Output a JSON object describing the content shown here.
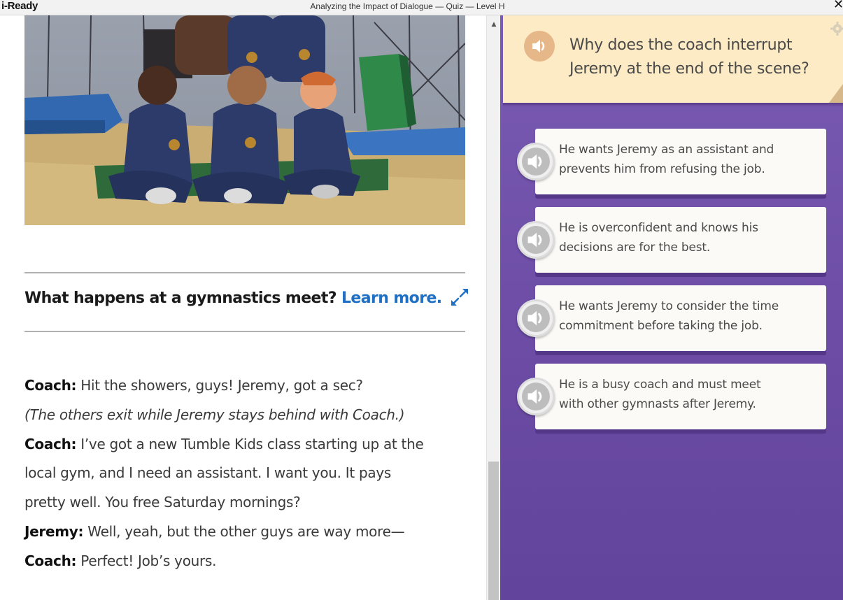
{
  "window": {
    "logo": "i-Ready",
    "title": "Analyzing the Impact of Dialogue — Quiz — Level H",
    "close_icon": "✕"
  },
  "reading": {
    "illustration": "gymnastics-team-illustration",
    "sidebar_prompt": "What happens at a gymnastics meet?",
    "learn_more": "Learn more.",
    "story_lines": [
      {
        "speaker": "Coach:",
        "text": " Hit the showers, guys! Jeremy, got a sec?"
      },
      {
        "stage": "(The others exit while Jeremy stays behind with Coach.)"
      },
      {
        "speaker": "Coach:",
        "text": " I’ve got a new Tumble Kids class starting up at the"
      },
      {
        "text": "local gym, and I need an assistant. I want you. It pays"
      },
      {
        "text": "pretty well. You free Saturday mornings?"
      },
      {
        "speaker": "Jeremy:",
        "text": " Well, yeah, but the other guys are way more—"
      },
      {
        "speaker": "Coach:",
        "text": " Perfect! Job’s yours."
      }
    ]
  },
  "quiz": {
    "question_lines": [
      "Why does the coach interrupt",
      "Jeremy at the end of the scene?"
    ],
    "answers": [
      {
        "lines": [
          "He wants Jeremy as an assistant and",
          "prevents him from refusing the job."
        ]
      },
      {
        "lines": [
          "He is overconfident and knows his",
          "decisions are for the best."
        ]
      },
      {
        "lines": [
          "He wants Jeremy to consider the time",
          "commitment before taking the job."
        ]
      },
      {
        "lines": [
          "He is a busy coach and must meet",
          "with other gymnasts after Jeremy."
        ]
      }
    ],
    "colors": {
      "panel": "#7357ae",
      "question_card": "#fdebc5",
      "audio_button": "#e6b889",
      "answer_card": "#fbfaf6",
      "link": "#1f6fc5"
    }
  },
  "scrollbar": {
    "up_arrow": "▲"
  }
}
